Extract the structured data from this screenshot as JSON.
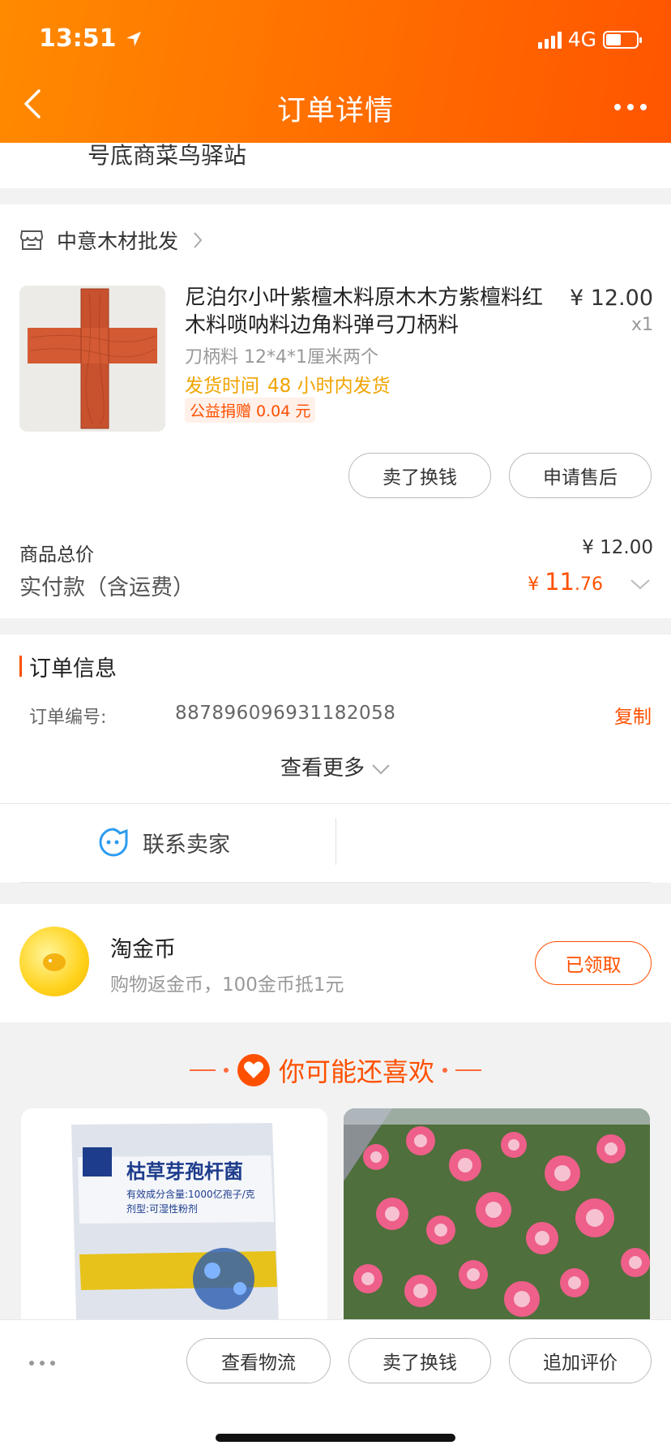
{
  "status_bar": {
    "time": "13:51",
    "network": "4G"
  },
  "header": {
    "title": "订单详情"
  },
  "address": {
    "partial_text": "号底商菜鸟驿站"
  },
  "shop": {
    "name": "中意木材批发",
    "item": {
      "title": "尼泊尔小叶紫檀木料原木木方紫檀料红木料唢呐料边角料弹弓刀柄料",
      "price": "¥ 12.00",
      "qty": "x1",
      "sku": "刀柄料 12*4*1厘米两个",
      "ship_label": "发货时间",
      "ship_value": "48 小时内发货",
      "charity": "公益捐赠 0.04 元"
    },
    "buttons": {
      "sell": "卖了换钱",
      "after_sale": "申请售后"
    },
    "total_label": "商品总价",
    "total_value": "¥ 12.00",
    "paid_label": "实付款（含运费）",
    "paid_currency": "¥ ",
    "paid_int": "11",
    "paid_dec": ".76"
  },
  "order_info": {
    "title": "订单信息",
    "number_label": "订单编号:",
    "number_value": "887896096931182058",
    "copy": "复制",
    "more": "查看更多",
    "contact": "联系卖家"
  },
  "coin": {
    "title": "淘金币",
    "subtitle": "购物返金币，100金币抵1元",
    "button": "已领取"
  },
  "recommend": {
    "title": "你可能还喜欢",
    "product1_lines": [
      "枯草芽孢杆菌",
      "有效成分含量:1000亿孢子/克",
      "剂型:可湿性粉剂"
    ]
  },
  "bottom_bar": {
    "logistics": "查看物流",
    "sell": "卖了换钱",
    "review": "追加评价"
  }
}
